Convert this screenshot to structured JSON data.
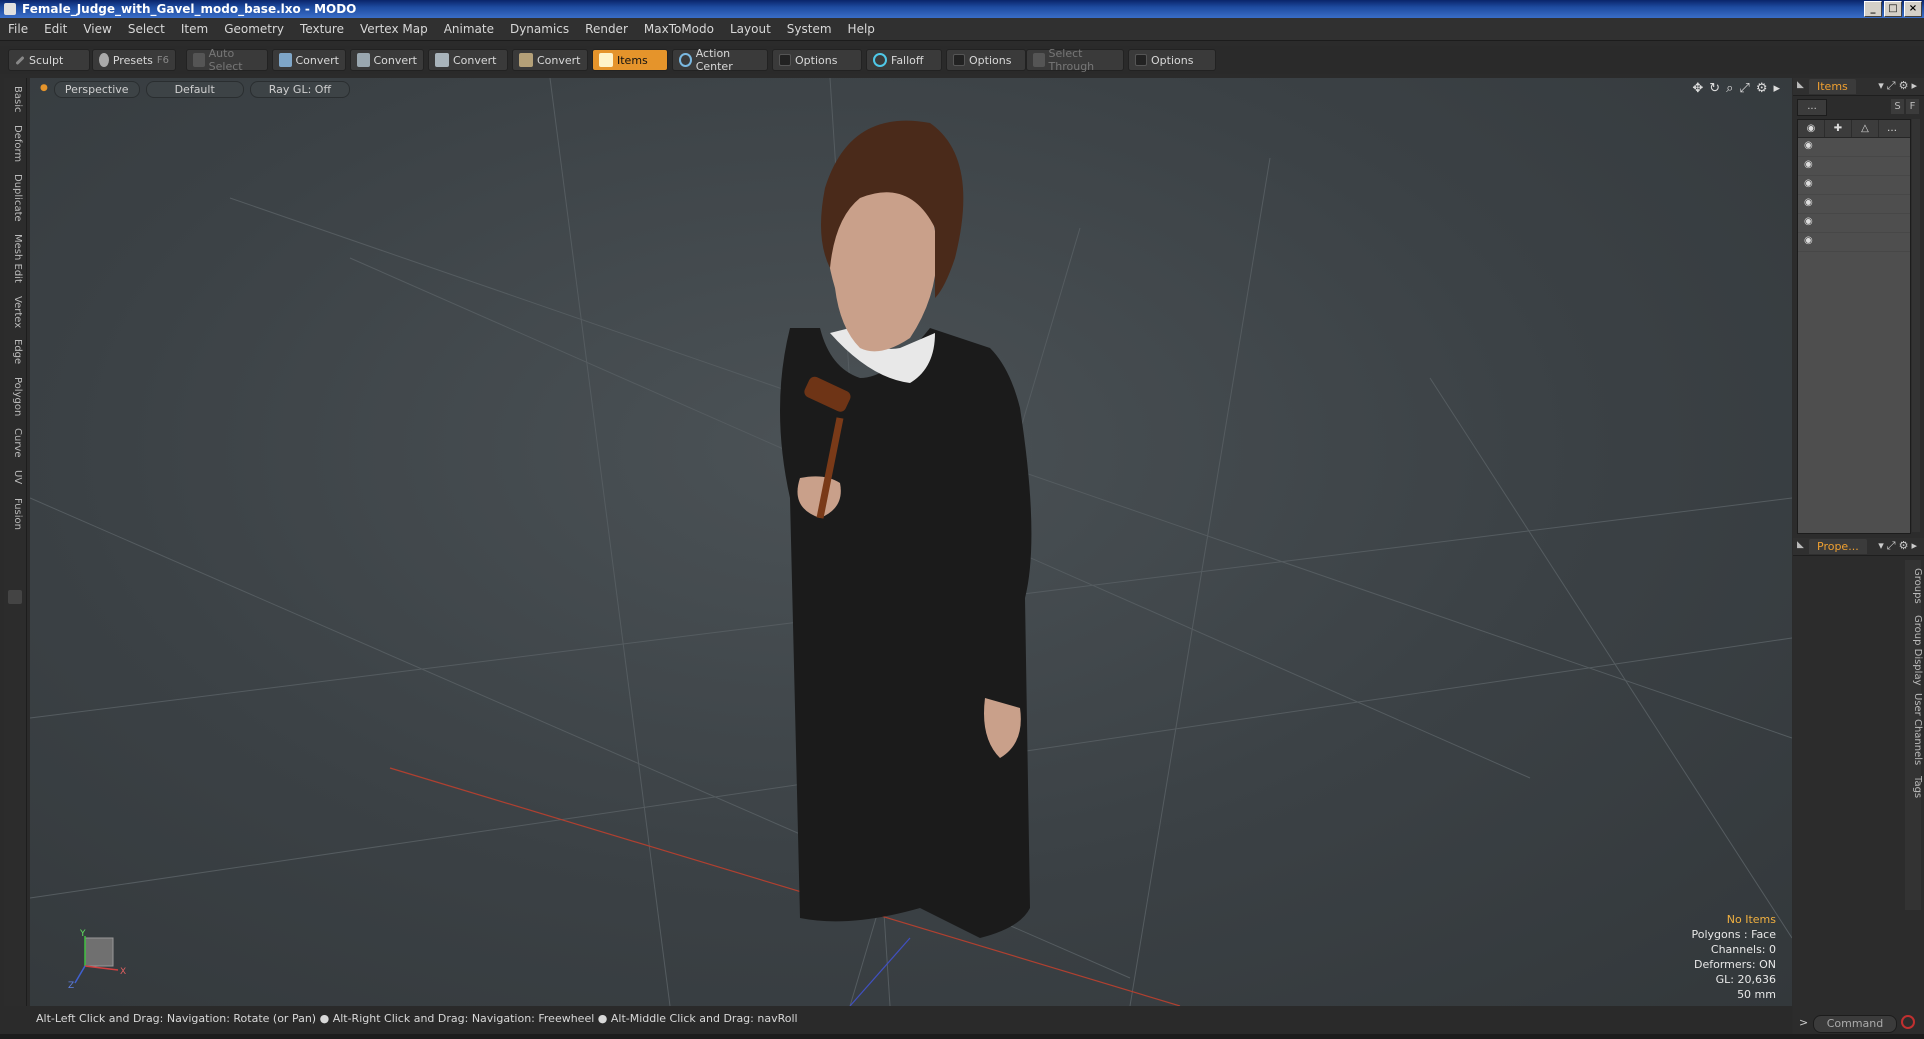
{
  "window": {
    "title": "Female_Judge_with_Gavel_modo_base.lxo - MODO",
    "controls": [
      "_",
      "□",
      "×"
    ]
  },
  "menu": [
    "File",
    "Edit",
    "View",
    "Select",
    "Item",
    "Geometry",
    "Texture",
    "Vertex Map",
    "Animate",
    "Dynamics",
    "Render",
    "MaxToModo",
    "Layout",
    "System",
    "Help"
  ],
  "toolbar": {
    "sculpt": "Sculpt",
    "presets": "Presets",
    "presets_key": "F6",
    "auto_select": "Auto Select",
    "convert1": "Convert",
    "convert2": "Convert",
    "convert3": "Convert",
    "convert4": "Convert",
    "items": "Items",
    "action_center": "Action Center",
    "options1": "Options",
    "falloff": "Falloff",
    "options2": "Options",
    "select_through": "Select Through",
    "options3": "Options"
  },
  "left_tabs": [
    "Basic",
    "Deform",
    "Duplicate",
    "Mesh Edit",
    "Vertex",
    "Edge",
    "Polygon",
    "Curve",
    "UV",
    "Fusion"
  ],
  "viewport": {
    "view": "Perspective",
    "shading": "Default",
    "raygl": "Ray GL: Off",
    "info": {
      "items": "No Items",
      "polygons": "Polygons : Face",
      "channels": "Channels: 0",
      "deformers": "Deformers: ON",
      "gl": "GL: 20,636",
      "lens": "50 mm"
    },
    "axis": {
      "x": "X",
      "y": "Y",
      "z": "Z"
    }
  },
  "status": "Alt-Left Click and Drag: Navigation: Rotate (or Pan) ● Alt-Right Click and Drag: Navigation: Freewheel ● Alt-Middle Click and Drag: navRoll",
  "right_panel": {
    "items_tab": "Items",
    "props_tab": "Prope...",
    "list_filter": "...",
    "s_button": "S",
    "f_button": "F",
    "props_tabs": [
      "Groups",
      "Group Display",
      "User Channels",
      "Tags"
    ]
  },
  "command": {
    "prompt": ">",
    "placeholder": "Command"
  }
}
